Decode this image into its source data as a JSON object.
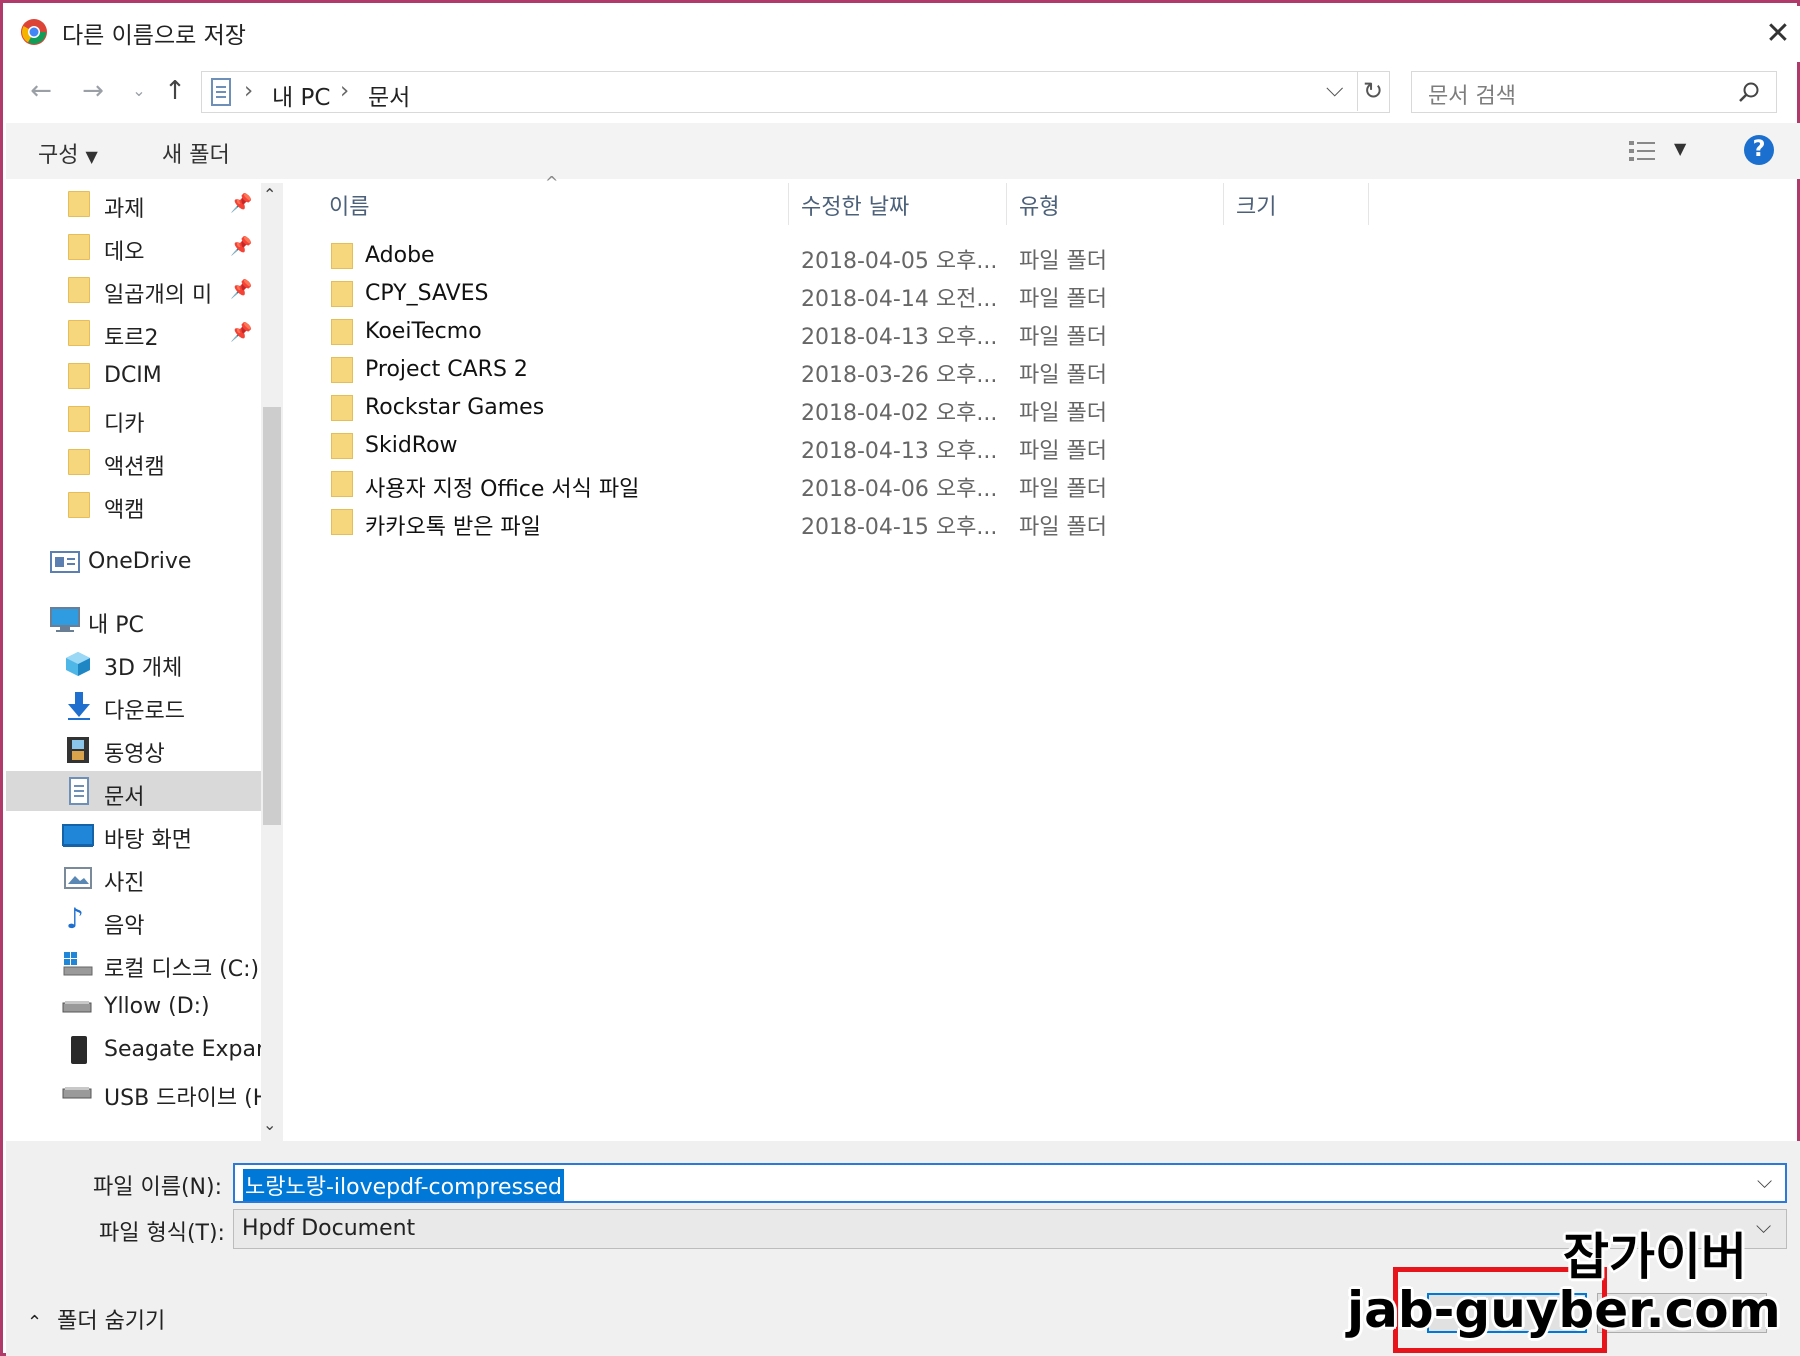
{
  "window": {
    "title": "다른 이름으로 저장"
  },
  "address": {
    "path": [
      "내 PC",
      "문서"
    ],
    "search_placeholder": "문서 검색"
  },
  "toolbar": {
    "organize": "구성",
    "new_folder": "새 폴더",
    "help": "?"
  },
  "sidebar": {
    "quick_access": [
      {
        "label": "과제",
        "pinned": true
      },
      {
        "label": "데오",
        "pinned": true
      },
      {
        "label": "일곱개의 미",
        "pinned": true
      },
      {
        "label": "토르2",
        "pinned": true
      },
      {
        "label": "DCIM",
        "pinned": false
      },
      {
        "label": "디카",
        "pinned": false
      },
      {
        "label": "액션캠",
        "pinned": false
      },
      {
        "label": "액캠",
        "pinned": false
      }
    ],
    "onedrive": "OneDrive",
    "this_pc": "내 PC",
    "pc_items": [
      {
        "label": "3D 개체",
        "icon": "cube-icon"
      },
      {
        "label": "다운로드",
        "icon": "download-arrow-icon"
      },
      {
        "label": "동영상",
        "icon": "film-icon"
      },
      {
        "label": "문서",
        "icon": "document-icon",
        "selected": true
      },
      {
        "label": "바탕 화면",
        "icon": "desktop-icon"
      },
      {
        "label": "사진",
        "icon": "pictures-icon"
      },
      {
        "label": "음악",
        "icon": "music-note-icon"
      },
      {
        "label": "로컬 디스크 (C:)",
        "icon": "disk-icon"
      },
      {
        "label": "Yllow (D:)",
        "icon": "drive-icon"
      },
      {
        "label": "Seagate Expansi",
        "icon": "external-drive-icon"
      },
      {
        "label": "USB 드라이브 (H",
        "icon": "usb-drive-icon"
      }
    ]
  },
  "columns": {
    "name": "이름",
    "modified": "수정한 날짜",
    "type": "유형",
    "size": "크기"
  },
  "files": [
    {
      "name": "Adobe",
      "date": "2018-04-05 오후...",
      "type": "파일 폴더"
    },
    {
      "name": "CPY_SAVES",
      "date": "2018-04-14 오전...",
      "type": "파일 폴더"
    },
    {
      "name": "KoeiTecmo",
      "date": "2018-04-13 오후...",
      "type": "파일 폴더"
    },
    {
      "name": "Project CARS 2",
      "date": "2018-03-26 오후...",
      "type": "파일 폴더"
    },
    {
      "name": "Rockstar Games",
      "date": "2018-04-02 오후...",
      "type": "파일 폴더"
    },
    {
      "name": "SkidRow",
      "date": "2018-04-13 오후...",
      "type": "파일 폴더"
    },
    {
      "name": "사용자 지정 Office 서식 파일",
      "date": "2018-04-06 오후...",
      "type": "파일 폴더"
    },
    {
      "name": "카카오톡 받은 파일",
      "date": "2018-04-15 오후...",
      "type": "파일 폴더"
    }
  ],
  "save_form": {
    "filename_label": "파일 이름(N):",
    "filename_value": "노랑노랑-ilovepdf-compressed",
    "filetype_label": "파일 형식(T):",
    "filetype_value": "Hpdf Document",
    "hide_folders": "폴더 숨기기"
  },
  "watermark": {
    "line1": "잡가이버",
    "line2": "jab-guyber.com"
  },
  "colors": {
    "frame": "#b03a6a",
    "selection": "#0078d7",
    "highlight_box": "#e8141c"
  }
}
